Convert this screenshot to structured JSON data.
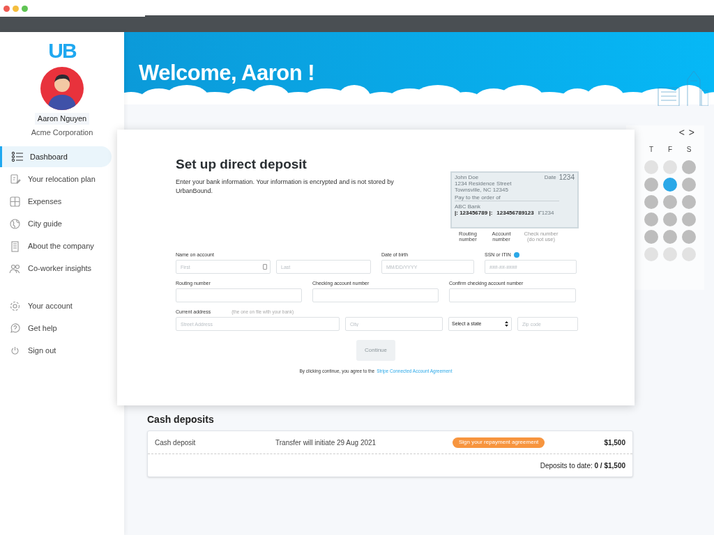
{
  "browser": {
    "lights": [
      {
        "color": "#ee5a52"
      },
      {
        "color": "#f5be3d"
      },
      {
        "color": "#5fc453"
      }
    ]
  },
  "sidebar": {
    "logo": "UB",
    "user": {
      "name": "Aaron Nguyen",
      "company": "Acme Corporation"
    },
    "items": [
      {
        "label": "Dashboard",
        "kind": "list",
        "selected": true
      },
      {
        "label": "Your relocation plan",
        "kind": "plan",
        "selected": false
      },
      {
        "label": "Expenses",
        "kind": "grid",
        "selected": false
      },
      {
        "label": "City guide",
        "kind": "globe",
        "selected": false
      },
      {
        "label": "About the company",
        "kind": "building",
        "selected": false
      },
      {
        "label": "Co-worker insights",
        "kind": "people",
        "selected": false
      }
    ],
    "footer_items": [
      {
        "label": "Your account",
        "kind": "gear",
        "selected": false
      },
      {
        "label": "Get help",
        "kind": "help",
        "selected": false
      },
      {
        "label": "Sign out",
        "kind": "power",
        "selected": false
      }
    ]
  },
  "banner": {
    "title": "Welcome, Aaron !"
  },
  "calendar": {
    "prev": "<",
    "next": ">",
    "weekdays": [
      "T",
      "F",
      "S"
    ],
    "days": [
      [
        {
          "available": false,
          "selected": false
        },
        {
          "available": false,
          "selected": false
        },
        {
          "available": true,
          "selected": false
        }
      ],
      [
        {
          "available": true,
          "selected": false
        },
        {
          "available": true,
          "selected": true
        },
        {
          "available": true,
          "selected": false
        }
      ],
      [
        {
          "available": true,
          "selected": false
        },
        {
          "available": true,
          "selected": false
        },
        {
          "available": true,
          "selected": false
        }
      ],
      [
        {
          "available": true,
          "selected": false
        },
        {
          "available": true,
          "selected": false
        },
        {
          "available": true,
          "selected": false
        }
      ],
      [
        {
          "available": true,
          "selected": false
        },
        {
          "available": true,
          "selected": false
        },
        {
          "available": true,
          "selected": false
        }
      ],
      [
        {
          "available": false,
          "selected": false
        },
        {
          "available": false,
          "selected": false
        },
        {
          "available": false,
          "selected": false
        }
      ]
    ]
  },
  "modal": {
    "title": "Set up direct deposit",
    "description": "Enter your bank information. Your information is encrypted and is not stored by UrbanBound.",
    "check": {
      "name": "John Doe",
      "street": "1234 Residence Street",
      "city": "Townsville, NC 12345",
      "date": "Date",
      "number": "1234",
      "pay_to": "Pay to the order of",
      "bank": "ABC Bank",
      "routing": "|: 123456789 |:",
      "account": "123456789123",
      "check_no": "⑈1234",
      "labels": [
        {
          "text": "Routing number",
          "muted": false
        },
        {
          "text": "Account number",
          "muted": false
        },
        {
          "text": "Check number (do not use)",
          "muted": true
        }
      ]
    },
    "rows": [
      {
        "fields": [
          {
            "label": "Name on account",
            "placeholder": "First",
            "icon": true
          },
          {
            "placeholder": "Last",
            "icon": false
          },
          {
            "label": "Date of birth",
            "placeholder": "MM/DD/YYYY",
            "icon": false
          },
          {
            "label": "SSN or ITIN",
            "placeholder": "###-##-####",
            "info": true,
            "icon": false
          }
        ]
      },
      {
        "fields": [
          {
            "label": "Routing number"
          },
          {
            "label": "Checking account number"
          },
          {
            "label": "Confirm checking account number"
          }
        ]
      },
      {
        "fields": [
          {
            "label": "Current address",
            "hint": "(the one on file with your bank)",
            "placeholder": "Street Address"
          },
          {
            "placeholder": "City"
          },
          {
            "kind": "select",
            "value": "Select a state"
          },
          {
            "placeholder": "Zip code"
          }
        ]
      }
    ],
    "continue": {
      "label": "Continue",
      "disabled": true
    },
    "agreement": {
      "text": "By clicking continue, you agree to the",
      "link": "Stripe Connected Account Agreement"
    }
  },
  "cash_deposits": {
    "title": "Cash deposits",
    "rows": [
      {
        "name": "Cash deposit",
        "status": "Transfer will initiate 29 Aug 2021",
        "action": "Sign your repayment agreement",
        "amount": "$1,500"
      }
    ],
    "total": "Deposits to date: **0 / $1,500**"
  }
}
